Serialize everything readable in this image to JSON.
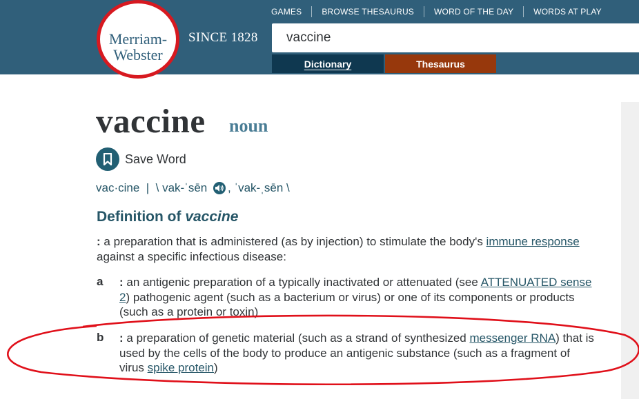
{
  "header": {
    "logo_line1": "Merriam-",
    "logo_line2": "Webster",
    "since": "SINCE 1828",
    "nav": [
      "GAMES",
      "BROWSE THESAURUS",
      "WORD OF THE DAY",
      "WORDS AT PLAY"
    ],
    "search_value": "vaccine",
    "tab_dictionary": "Dictionary",
    "tab_thesaurus": "Thesaurus"
  },
  "entry": {
    "headword": "vaccine",
    "pos": "noun",
    "save_label": "Save Word",
    "syllables": "vac·cine",
    "pron_sep": "  |  ",
    "pron_open": "\\ vak-ˈsēn ",
    "pron_after_audio": ", ˈvak-ˌsēn \\",
    "def_heading_prefix": "Definition of ",
    "def_heading_word": "vaccine"
  },
  "definitions": {
    "main": {
      "text1": " a preparation that is administered (as by injection) to stimulate the body's ",
      "link1": "immune response",
      "text2": " against a specific infectious disease:"
    },
    "a": {
      "letter": "a",
      "text1": " an antigenic preparation of a typically inactivated or attenuated (see ",
      "link1": "ATTENUATED sense 2",
      "text2": ") pathogenic agent (such as a bacterium or virus) or one of its components or products (such as a protein or toxin)"
    },
    "b": {
      "letter": "b",
      "text1": " a preparation of genetic material (such as a strand of synthesized ",
      "link1": "messenger RNA",
      "text2": ") that is used by the cells of the body to produce an antigenic substance (such as a fragment of virus ",
      "link2": "spike protein",
      "text3": ")"
    }
  },
  "colors": {
    "header_bg": "#305f7a",
    "dictionary_tab": "#0f3850",
    "thesaurus_tab": "#97380c",
    "annotation_ellipse": "#e0101a"
  },
  "icons": [
    "bookmark-icon",
    "speaker-icon"
  ]
}
